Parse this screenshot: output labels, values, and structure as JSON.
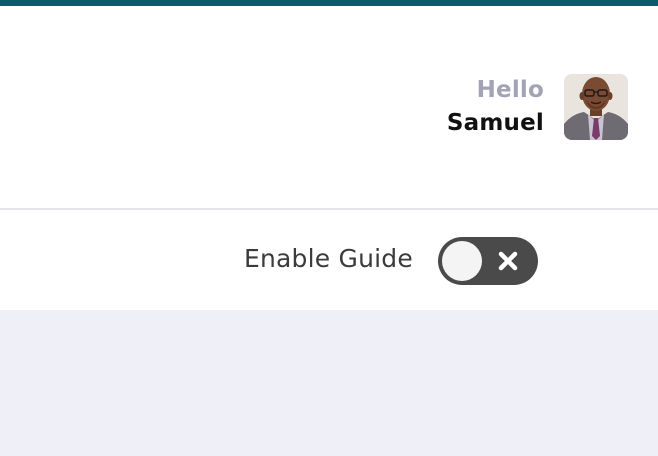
{
  "header": {
    "greeting": "Hello",
    "user_name": "Samuel"
  },
  "guide": {
    "label": "Enable Guide",
    "enabled": false,
    "toggle_icon": "close-icon"
  },
  "colors": {
    "top_bar": "#0e5a6a",
    "greeting": "#a3a3b5",
    "name": "#111111",
    "toggle_off": "#4a4a4a",
    "content_bg": "#efeff8"
  }
}
